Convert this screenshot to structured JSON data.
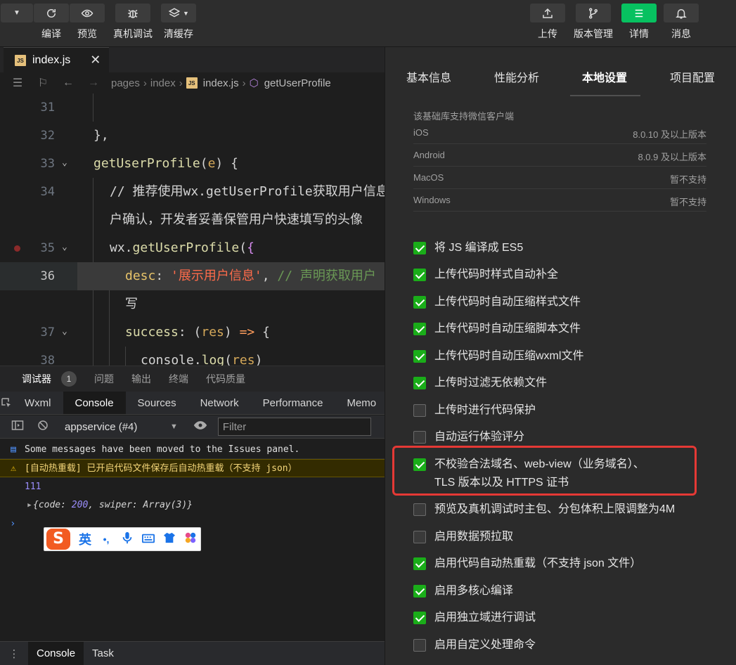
{
  "toolbar": {
    "left_buttons": [
      {
        "label": "编译",
        "icon": "refresh-icon"
      },
      {
        "label": "预览",
        "icon": "eye-icon"
      },
      {
        "label": "真机调试",
        "icon": "bug-icon"
      },
      {
        "label": "清缓存",
        "icon": "layers-icon"
      }
    ],
    "right_buttons": [
      {
        "label": "上传",
        "icon": "upload-icon"
      },
      {
        "label": "版本管理",
        "icon": "branch-icon"
      },
      {
        "label": "详情",
        "icon": "menu-icon"
      },
      {
        "label": "消息",
        "icon": "bell-icon"
      }
    ]
  },
  "editor": {
    "file_tab": "index.js",
    "file_badge": "JS",
    "breadcrumb": [
      "pages",
      "index",
      "index.js",
      "getUserProfile"
    ],
    "lines": [
      {
        "no": "31",
        "code": ""
      },
      {
        "no": "32",
        "code": "},"
      },
      {
        "no": "33",
        "code": "getUserProfile(e) {"
      },
      {
        "no": "34",
        "code": "// 推荐使用wx.getUserProfile获取用户信息"
      },
      {
        "no": "",
        "code": "户确认，开发者妥善保管用户快速填写的头像"
      },
      {
        "no": "35",
        "code": "wx.getUserProfile({"
      },
      {
        "no": "36",
        "code": "desc: '展示用户信息', // 声明获取用户"
      },
      {
        "no": "",
        "code": "写"
      },
      {
        "no": "37",
        "code": "success: (res) => {"
      },
      {
        "no": "38",
        "code": "console.log(res)"
      }
    ]
  },
  "debugger": {
    "tabs": [
      "调试器",
      "问题",
      "输出",
      "终端",
      "代码质量"
    ],
    "badge": "1",
    "devtools_tabs": [
      "Wxml",
      "Console",
      "Sources",
      "Network",
      "Performance",
      "Memo"
    ],
    "active_devtools_tab": "Console",
    "context": "appservice (#4)",
    "filter_placeholder": "Filter",
    "messages": {
      "info": "Some messages have been moved to the Issues panel.",
      "warn": "[自动热重载] 已开启代码文件保存后自动热重载（不支持 json）",
      "number": "111",
      "object_prefix": "{code: ",
      "object_code": "200",
      "object_suffix": ", swiper: Array(3)}"
    },
    "bottom_tabs": [
      "Console",
      "Task"
    ]
  },
  "ime": {
    "logo": "S",
    "mode": "英",
    "punct": "•,"
  },
  "settings": {
    "tabs": [
      "基本信息",
      "性能分析",
      "本地设置",
      "项目配置"
    ],
    "active_tab": "本地设置",
    "base_lib_title": "该基础库支持微信客户端",
    "base_lib": [
      {
        "name": "iOS",
        "value": "8.0.10 及以上版本"
      },
      {
        "name": "Android",
        "value": "8.0.9 及以上版本"
      },
      {
        "name": "MacOS",
        "value": "暂不支持"
      },
      {
        "name": "Windows",
        "value": "暂不支持"
      }
    ],
    "options": [
      {
        "label": "将 JS 编译成 ES5",
        "checked": true
      },
      {
        "label": "上传代码时样式自动补全",
        "checked": true
      },
      {
        "label": "上传代码时自动压缩样式文件",
        "checked": true
      },
      {
        "label": "上传代码时自动压缩脚本文件",
        "checked": true
      },
      {
        "label": "上传代码时自动压缩wxml文件",
        "checked": true
      },
      {
        "label": "上传时过滤无依赖文件",
        "checked": true
      },
      {
        "label": "上传时进行代码保护",
        "checked": false
      },
      {
        "label": "自动运行体验评分",
        "checked": false
      },
      {
        "label": "不校验合法域名、web-view（业务域名）、TLS 版本以及 HTTPS 证书",
        "checked": true
      },
      {
        "label": "预览及真机调试时主包、分包体积上限调整为4M",
        "checked": false
      },
      {
        "label": "启用数据预拉取",
        "checked": false
      },
      {
        "label": "启用代码自动热重载（不支持 json 文件）",
        "checked": true
      },
      {
        "label": "启用多核心编译",
        "checked": true
      },
      {
        "label": "启用独立域进行调试",
        "checked": true
      },
      {
        "label": "启用自定义处理命令",
        "checked": false
      }
    ]
  },
  "colors": {
    "accent": "#07c160",
    "checkbox": "#1aad19",
    "highlight_box": "#e53935"
  }
}
